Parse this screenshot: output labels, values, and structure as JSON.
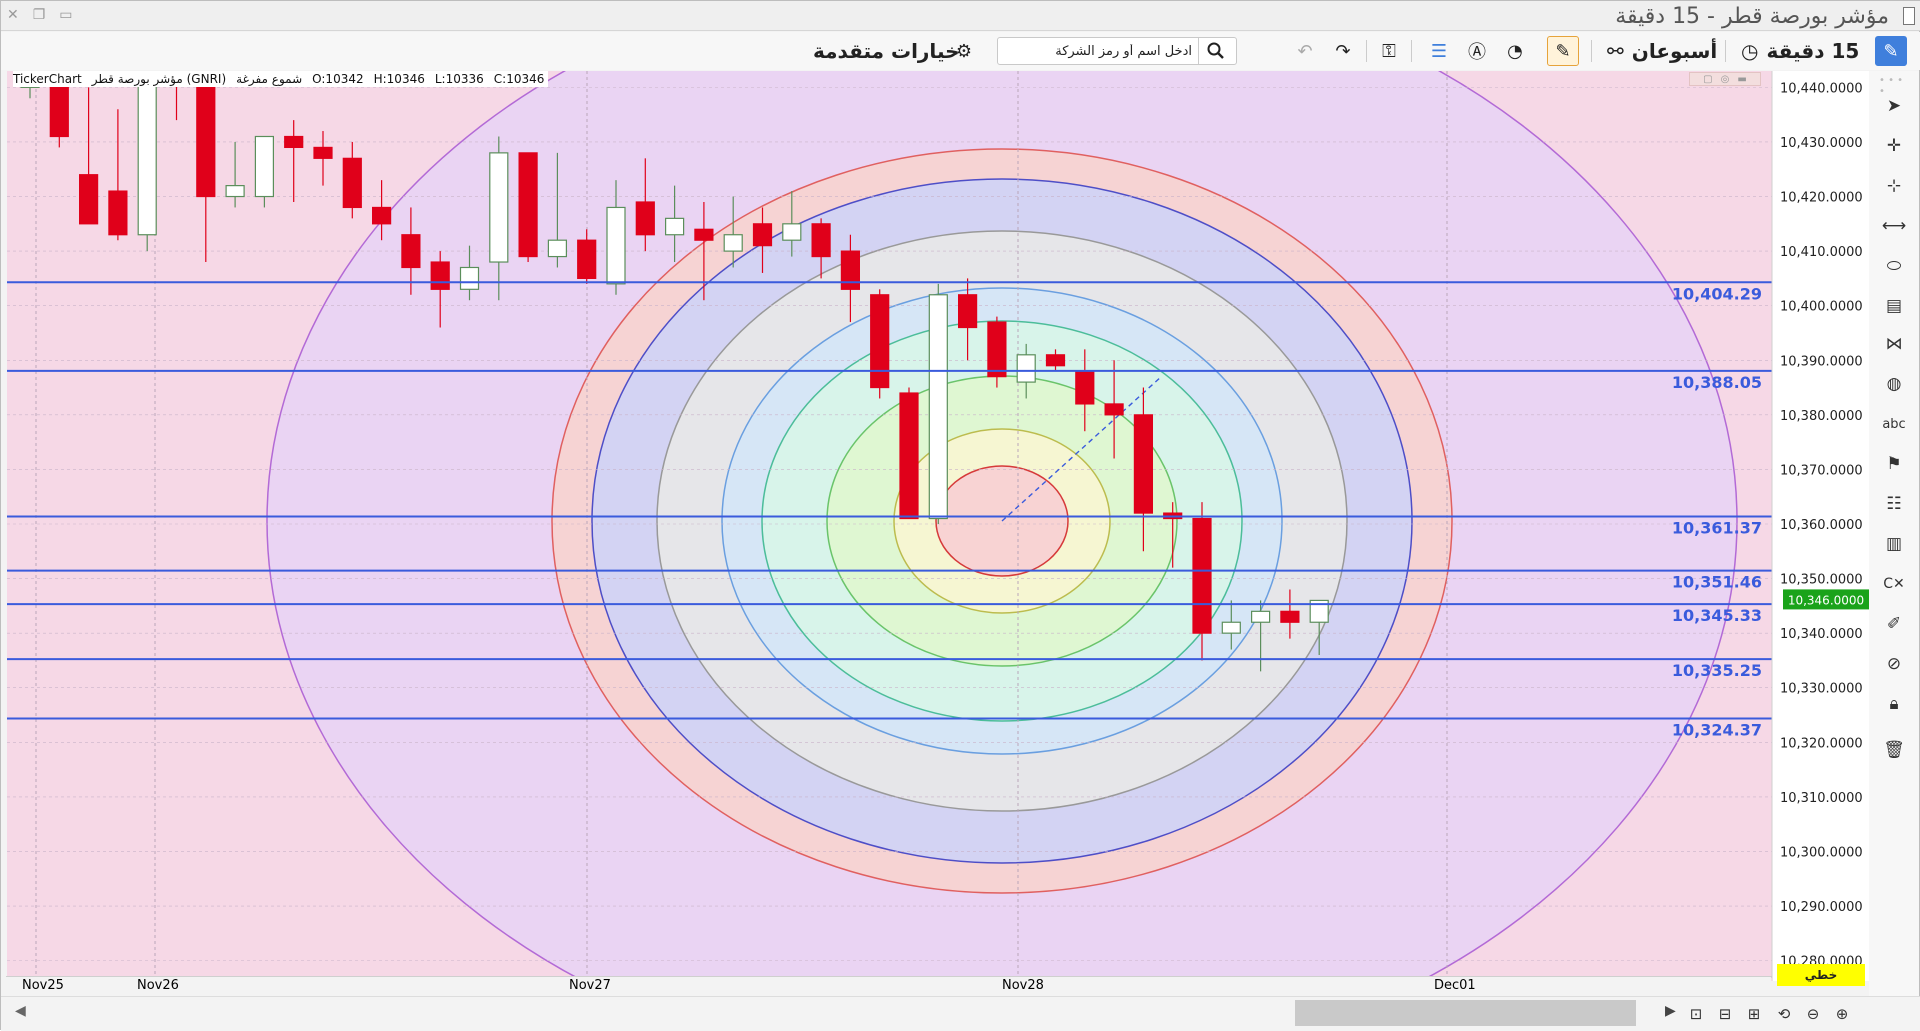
{
  "window": {
    "title": "مؤشر بورصة قطر - 15 دقيقة"
  },
  "toolbar": {
    "interval_label": "15 دقيقة",
    "range_label": "أسبوعان",
    "search_placeholder": "ادخل اسم أو رمز الشركة",
    "advanced_options_label": "خيارات متقدمة"
  },
  "legend": {
    "source": "TickerChart",
    "instrument": "مؤشر بورصة قطر (GNRI)",
    "chart_style": "شموع مفرغة",
    "open": "O:10342",
    "high": "H:10346",
    "low": "L:10336",
    "close": "C:10346"
  },
  "price_badge": "10,346.0000",
  "chart_type_badge": "خطي",
  "colors": {
    "down_candle": "#e0001a",
    "up_candle": "#8cc08c",
    "level_line": "#3a5bdc",
    "price_badge": "#1aa31a",
    "badge_yellow": "#ffff00",
    "accent": "#3f7fdc"
  },
  "icons": {
    "draw_tool": "pencil-icon",
    "clock": "clock-icon",
    "range": "link-icon",
    "indicators": "gauge-icon",
    "alert": "a-circle-icon",
    "settings": "gear-icon",
    "search": "magnifier-icon",
    "undo": "undo-icon",
    "redo": "redo-icon"
  },
  "chart_data": {
    "type": "candlestick",
    "ylim": [
      10277,
      10443
    ],
    "y_ticks": [
      "10,440.0000",
      "10,430.0000",
      "10,420.0000",
      "10,410.0000",
      "10,400.0000",
      "10,390.0000",
      "10,380.0000",
      "10,370.0000",
      "10,360.0000",
      "10,350.0000",
      "10,340.0000",
      "10,330.0000",
      "10,320.0000",
      "10,310.0000",
      "10,300.0000",
      "10,290.0000",
      "10,280.0000"
    ],
    "x_labels": [
      "Nov25",
      "Nov26",
      "Nov27",
      "Nov28",
      "Dec01"
    ],
    "level_lines": [
      {
        "value": 10404.29,
        "label": "10,404.29"
      },
      {
        "value": 10388.05,
        "label": "10,388.05"
      },
      {
        "value": 10361.37,
        "label": "10,361.37"
      },
      {
        "value": 10351.46,
        "label": "10,351.46"
      },
      {
        "value": 10345.33,
        "label": "10,345.33"
      },
      {
        "value": 10335.25,
        "label": "10,335.25"
      },
      {
        "value": 10324.37,
        "label": "10,324.37"
      }
    ],
    "last_price": 10346,
    "candles": [
      {
        "o": 10440,
        "h": 10443,
        "l": 10438,
        "c": 10442
      },
      {
        "o": 10442,
        "h": 10445,
        "l": 10429,
        "c": 10431
      },
      {
        "o": 10424,
        "h": 10440,
        "l": 10417,
        "c": 10415
      },
      {
        "o": 10421,
        "h": 10436,
        "l": 10412,
        "c": 10413
      },
      {
        "o": 10413,
        "h": 10445,
        "l": 10410,
        "c": 10444
      },
      {
        "o": 10443,
        "h": 10446,
        "l": 10434,
        "c": 10441
      },
      {
        "o": 10441,
        "h": 10445,
        "l": 10408,
        "c": 10420
      },
      {
        "o": 10420,
        "h": 10430,
        "l": 10418,
        "c": 10422
      },
      {
        "o": 10420,
        "h": 10431,
        "l": 10418,
        "c": 10431
      },
      {
        "o": 10431,
        "h": 10434,
        "l": 10419,
        "c": 10429
      },
      {
        "o": 10429,
        "h": 10432,
        "l": 10422,
        "c": 10427
      },
      {
        "o": 10427,
        "h": 10430,
        "l": 10416,
        "c": 10418
      },
      {
        "o": 10418,
        "h": 10423,
        "l": 10412,
        "c": 10415
      },
      {
        "o": 10413,
        "h": 10418,
        "l": 10402,
        "c": 10407
      },
      {
        "o": 10408,
        "h": 10410,
        "l": 10396,
        "c": 10403
      },
      {
        "o": 10403,
        "h": 10411,
        "l": 10401,
        "c": 10407
      },
      {
        "o": 10408,
        "h": 10431,
        "l": 10401,
        "c": 10428
      },
      {
        "o": 10428,
        "h": 10428,
        "l": 10408,
        "c": 10409
      },
      {
        "o": 10409,
        "h": 10428,
        "l": 10407,
        "c": 10412
      },
      {
        "o": 10412,
        "h": 10414,
        "l": 10404,
        "c": 10405
      },
      {
        "o": 10404,
        "h": 10423,
        "l": 10402,
        "c": 10418
      },
      {
        "o": 10419,
        "h": 10427,
        "l": 10410,
        "c": 10413
      },
      {
        "o": 10413,
        "h": 10422,
        "l": 10408,
        "c": 10416
      },
      {
        "o": 10414,
        "h": 10419,
        "l": 10401,
        "c": 10412
      },
      {
        "o": 10410,
        "h": 10420,
        "l": 10407,
        "c": 10413
      },
      {
        "o": 10415,
        "h": 10418,
        "l": 10406,
        "c": 10411
      },
      {
        "o": 10412,
        "h": 10421,
        "l": 10409,
        "c": 10415
      },
      {
        "o": 10415,
        "h": 10416,
        "l": 10405,
        "c": 10409
      },
      {
        "o": 10410,
        "h": 10413,
        "l": 10397,
        "c": 10403
      },
      {
        "o": 10402,
        "h": 10403,
        "l": 10383,
        "c": 10385
      },
      {
        "o": 10384,
        "h": 10385,
        "l": 10361,
        "c": 10361
      },
      {
        "o": 10361,
        "h": 10404,
        "l": 10360,
        "c": 10402
      },
      {
        "o": 10402,
        "h": 10405,
        "l": 10390,
        "c": 10396
      },
      {
        "o": 10397,
        "h": 10398,
        "l": 10385,
        "c": 10387
      },
      {
        "o": 10386,
        "h": 10393,
        "l": 10383,
        "c": 10391
      },
      {
        "o": 10391,
        "h": 10392,
        "l": 10388,
        "c": 10389
      },
      {
        "o": 10388,
        "h": 10392,
        "l": 10377,
        "c": 10382
      },
      {
        "o": 10382,
        "h": 10390,
        "l": 10372,
        "c": 10380
      },
      {
        "o": 10380,
        "h": 10385,
        "l": 10355,
        "c": 10362
      },
      {
        "o": 10362,
        "h": 10364,
        "l": 10352,
        "c": 10361
      },
      {
        "o": 10361,
        "h": 10364,
        "l": 10335,
        "c": 10340
      },
      {
        "o": 10340,
        "h": 10346,
        "l": 10337,
        "c": 10342
      },
      {
        "o": 10342,
        "h": 10346,
        "l": 10333,
        "c": 10344
      },
      {
        "o": 10344,
        "h": 10348,
        "l": 10339,
        "c": 10342
      },
      {
        "o": 10342,
        "h": 10346,
        "l": 10336,
        "c": 10346
      }
    ]
  }
}
